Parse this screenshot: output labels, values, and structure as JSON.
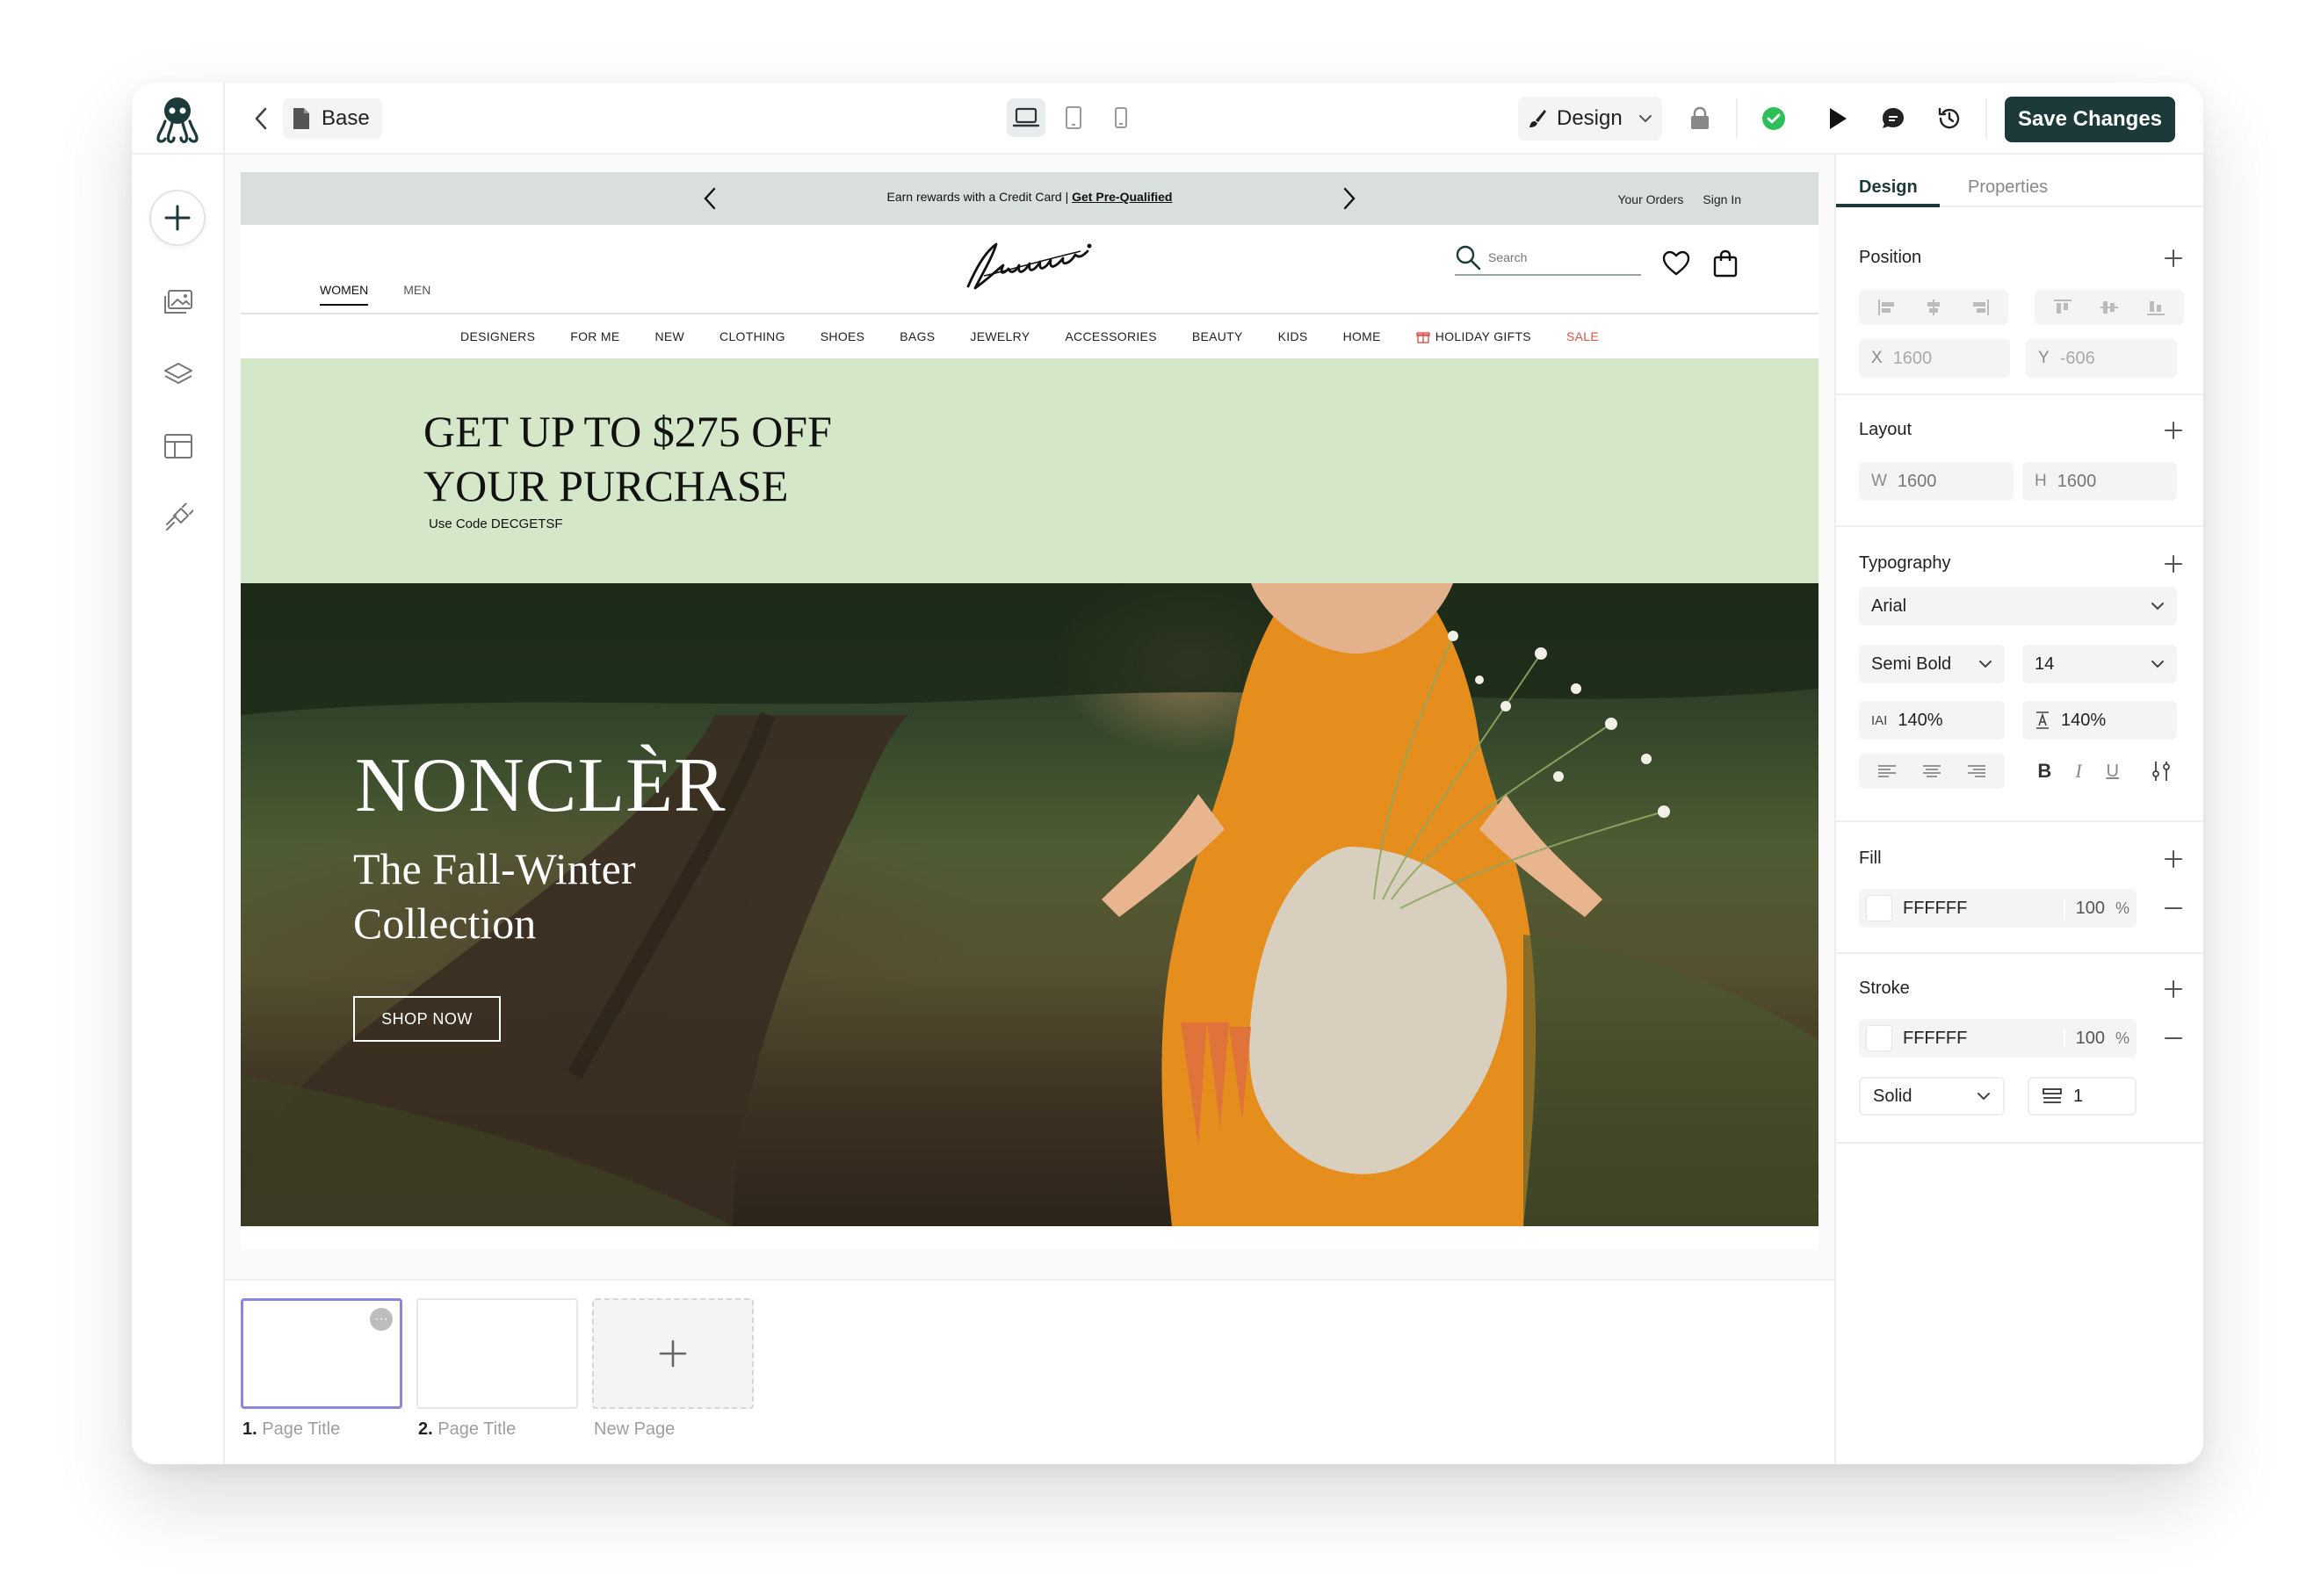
{
  "topbar": {
    "doc_title": "Base",
    "mode_label": "Design",
    "save_label": "Save Changes",
    "accent": "#1c3a3a"
  },
  "site": {
    "promo": {
      "text": "Earn rewards with a Credit Card | ",
      "link": "Get Pre-Qualified",
      "orders": "Your Orders",
      "signin": "Sign In"
    },
    "gender_tabs": [
      "WOMEN",
      "MEN"
    ],
    "search_placeholder": "Search",
    "nav": [
      "DESIGNERS",
      "FOR ME",
      "NEW",
      "CLOTHING",
      "SHOES",
      "BAGS",
      "JEWELRY",
      "ACCESSORIES",
      "BEAUTY",
      "KIDS",
      "HOME",
      "HOLIDAY GIFTS",
      "SALE"
    ],
    "banner": {
      "line1": "GET UP TO $275 OFF",
      "line2": "YOUR PURCHASE",
      "code": "Use Code DECGETSF",
      "bg": "#d4e7c8"
    },
    "hero": {
      "title": "NONCLÈR",
      "sub1": "The Fall-Winter",
      "sub2": "Collection",
      "cta": "SHOP NOW"
    }
  },
  "pages": {
    "items": [
      {
        "num": "1.",
        "title": "Page Title"
      },
      {
        "num": "2.",
        "title": "Page Title"
      }
    ],
    "new_label": "New Page"
  },
  "panel": {
    "tabs": [
      "Design",
      "Properties"
    ],
    "position": {
      "title": "Position",
      "x_label": "X",
      "x_value": "1600",
      "y_label": "Y",
      "y_value": "-606"
    },
    "layout": {
      "title": "Layout",
      "w_label": "W",
      "w_value": "1600",
      "h_label": "H",
      "h_value": "1600"
    },
    "typography": {
      "title": "Typography",
      "font": "Arial",
      "weight": "Semi Bold",
      "size": "14",
      "letter_icon": "IAI",
      "letter_spacing": "140%",
      "line_height": "140%",
      "bold": "B",
      "italic": "I",
      "underline": "U"
    },
    "fill": {
      "title": "Fill",
      "hex": "FFFFFF",
      "opacity": "100",
      "unit": "%"
    },
    "stroke": {
      "title": "Stroke",
      "hex": "FFFFFF",
      "opacity": "100",
      "unit": "%",
      "style": "Solid",
      "width": "1"
    }
  }
}
